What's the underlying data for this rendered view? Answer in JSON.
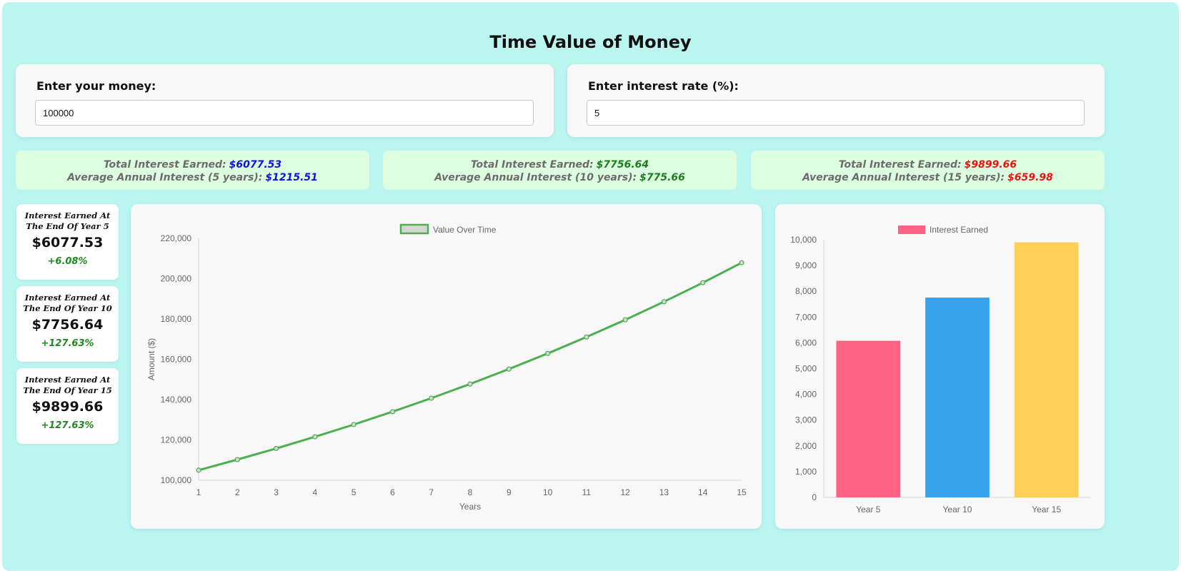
{
  "title": "Time Value of Money",
  "inputs": {
    "money_label": "Enter your money:",
    "money_value": "100000",
    "rate_label": "Enter interest rate (%):",
    "rate_value": "5"
  },
  "summaries": [
    {
      "total_label": "Total Interest Earned:",
      "total_value": "$6077.53",
      "avg_label": "Average Annual Interest (5 years):",
      "avg_value": "$1215.51",
      "color": "#1010e6"
    },
    {
      "total_label": "Total Interest Earned:",
      "total_value": "$7756.64",
      "avg_label": "Average Annual Interest (10 years):",
      "avg_value": "$775.66",
      "color": "#1e7d1e"
    },
    {
      "total_label": "Total Interest Earned:",
      "total_value": "$9899.66",
      "avg_label": "Average Annual Interest (15 years):",
      "avg_value": "$659.98",
      "color": "#ee1111"
    }
  ],
  "stats": [
    {
      "title_line1": "Interest Earned At",
      "title_line2": "The End Of Year 5",
      "value": "$6077.53",
      "change": "+6.08%"
    },
    {
      "title_line1": "Interest Earned At",
      "title_line2": "The End Of Year 10",
      "value": "$7756.64",
      "change": "+127.63%"
    },
    {
      "title_line1": "Interest Earned At",
      "title_line2": "The End Of Year 15",
      "value": "$9899.66",
      "change": "+127.63%"
    }
  ],
  "chart_data": [
    {
      "type": "line",
      "series": [
        {
          "name": "Value Over Time",
          "color": "#4caf50",
          "x": [
            1,
            2,
            3,
            4,
            5,
            6,
            7,
            8,
            9,
            10,
            11,
            12,
            13,
            14,
            15
          ],
          "values": [
            105000,
            110250,
            115763,
            121551,
            127628,
            134010,
            140710,
            147746,
            155133,
            162889,
            171034,
            179586,
            188565,
            197993,
            207893
          ]
        }
      ],
      "xlabel": "Years",
      "ylabel": "Amount ($)",
      "ylim": [
        100000,
        220000
      ],
      "yticks": [
        "100,000",
        "120,000",
        "140,000",
        "160,000",
        "180,000",
        "200,000",
        "220,000"
      ],
      "xticks": [
        "1",
        "2",
        "3",
        "4",
        "5",
        "6",
        "7",
        "8",
        "9",
        "10",
        "11",
        "12",
        "13",
        "14",
        "15"
      ],
      "legend": "top"
    },
    {
      "type": "bar",
      "categories": [
        "Year 5",
        "Year 10",
        "Year 15"
      ],
      "series": [
        {
          "name": "Interest Earned",
          "values": [
            6077.53,
            7756.64,
            9899.66
          ]
        }
      ],
      "colors": [
        "#ff6384",
        "#36a2eb",
        "#ffce56"
      ],
      "ylim": [
        0,
        10000
      ],
      "yticks": [
        "0",
        "1,000",
        "2,000",
        "3,000",
        "4,000",
        "5,000",
        "6,000",
        "7,000",
        "8,000",
        "9,000",
        "10,000"
      ],
      "legend": "top"
    }
  ]
}
